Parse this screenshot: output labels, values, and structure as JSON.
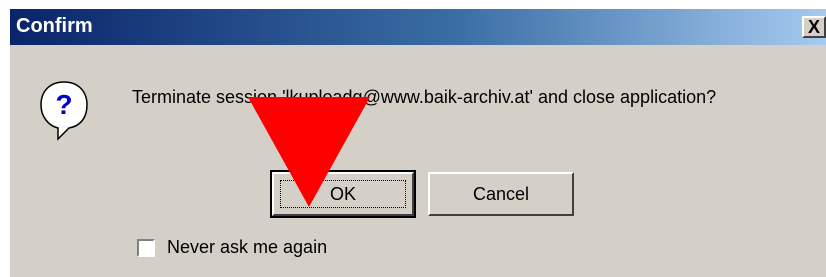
{
  "window": {
    "title": "Confirm",
    "close_label": "X"
  },
  "icon": {
    "name": "question-icon",
    "glyph": "?"
  },
  "message": "Terminate session 'lkuploadg@www.baik-archiv.at' and close application?",
  "buttons": {
    "ok_label": "OK",
    "cancel_label": "Cancel"
  },
  "checkbox": {
    "label": "Never ask me again",
    "checked": false
  },
  "colors": {
    "dialog_bg": "#d4d0c8",
    "titlebar_start": "#0a246a",
    "titlebar_end": "#a6caf0",
    "annotation_arrow": "#ff0000"
  }
}
